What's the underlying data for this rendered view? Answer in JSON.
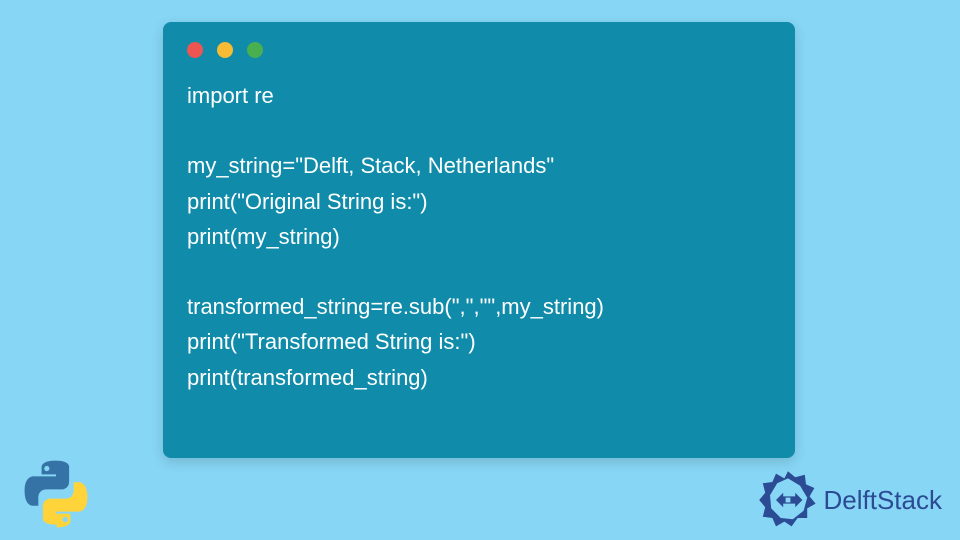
{
  "code": {
    "lines": [
      "import re",
      "",
      "my_string=\"Delft, Stack, Netherlands\"",
      "print(\"Original String is:\")",
      "print(my_string)",
      "",
      "transformed_string=re.sub(\",\",\"\",my_string)",
      "print(\"Transformed String is:\")",
      "print(transformed_string)"
    ]
  },
  "brand": {
    "name": "DelftStack"
  },
  "icons": {
    "python": "python-icon",
    "delft": "delft-icon"
  },
  "colors": {
    "background": "#87d6f5",
    "codebox": "#108caa",
    "text": "#ffffff",
    "brand": "#2b4b94"
  }
}
